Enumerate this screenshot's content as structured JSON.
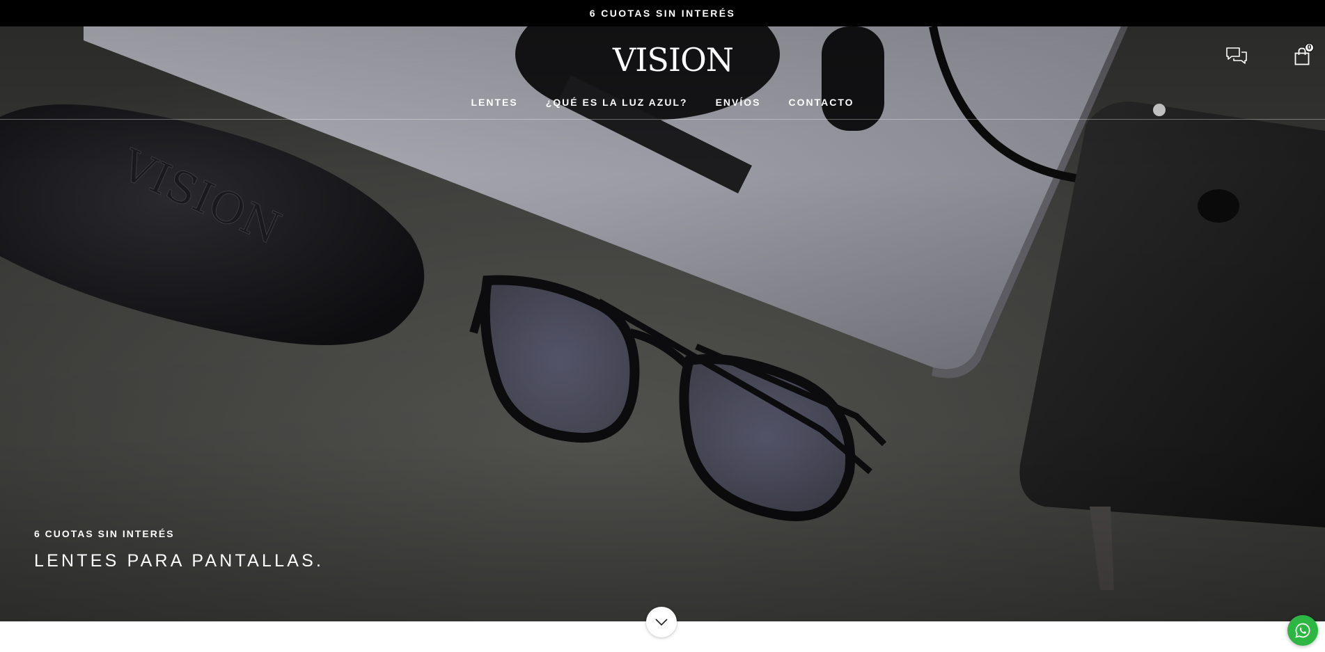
{
  "announcement": {
    "text": "6 CUOTAS SIN INTERÉS"
  },
  "header": {
    "logo_text": "VISION",
    "nav": [
      {
        "label": "LENTES"
      },
      {
        "label": "¿QUÉ ES LA LUZ AZUL?"
      },
      {
        "label": "ENVÍOS"
      },
      {
        "label": "CONTACTO"
      }
    ],
    "icons": {
      "chat": "chat-bubbles-icon",
      "cart": "shopping-bag-icon"
    },
    "cart_count": "0"
  },
  "hero": {
    "kicker": "6 CUOTAS SIN INTERÉS",
    "title": "LENTES PARA PANTALLAS.",
    "case_engraving": "VISION"
  },
  "floating": {
    "scroll_icon": "chevron-down-icon",
    "whatsapp_icon": "whatsapp-icon"
  },
  "colors": {
    "announcement_bg": "#000000",
    "whatsapp_green": "#2db742",
    "text_on_hero": "#ffffff"
  }
}
